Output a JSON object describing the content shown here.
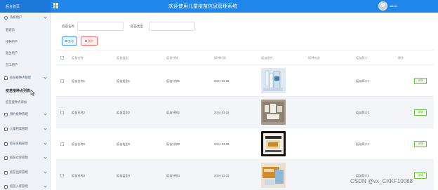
{
  "header": {
    "home": "后台首页",
    "title": "欢迎使用儿童疫苗信息管理系统",
    "username": "admin"
  },
  "sidebar": {
    "items": [
      {
        "label": "系统用户",
        "type": "group",
        "icon": "user-icon"
      },
      {
        "label": "管理员",
        "type": "child"
      },
      {
        "label": "接种用户",
        "type": "child"
      },
      {
        "label": "医生用户",
        "type": "child"
      },
      {
        "label": "员工用户",
        "type": "child"
      },
      {
        "label": "疫苗接种点管理",
        "type": "group",
        "icon": "folder-icon"
      },
      {
        "label": "疫苗接种点列表",
        "type": "active-child"
      },
      {
        "label": "疫苗接种点添加",
        "type": "child"
      },
      {
        "label": "预约接种管理",
        "type": "group",
        "icon": "folder-icon"
      },
      {
        "label": "儿童档案管理",
        "type": "group",
        "icon": "folder-icon"
      },
      {
        "label": "疫苗采购管理",
        "type": "group",
        "icon": "folder-icon"
      },
      {
        "label": "疫苗仓库管理",
        "type": "group",
        "icon": "folder-icon"
      },
      {
        "label": "疫苗出库管理",
        "type": "group",
        "icon": "folder-icon"
      },
      {
        "label": "疫苗入库管理",
        "type": "group",
        "icon": "folder-icon"
      }
    ]
  },
  "search": {
    "name_label": "疫苗名称",
    "type_label": "疫苗类型",
    "name_value": "",
    "type_value": "",
    "query_button": "查询",
    "delete_button": "删除"
  },
  "table": {
    "columns": [
      "疫苗名称",
      "疫苗类型",
      "疫苗针数",
      "接种时间",
      "疫苗图片",
      "接种剂次",
      "疫苗简介",
      "操作"
    ],
    "rows": [
      {
        "name": "疫苗名称1",
        "type": "疫苗类型1",
        "doses": "疫苗针数1",
        "date": "2024-03-26",
        "schedule": "",
        "intro": "疫苗简介1",
        "action": "详情"
      },
      {
        "name": "疫苗名称2",
        "type": "疫苗类型2",
        "doses": "疫苗针数2",
        "date": "2024-03-26",
        "schedule": "",
        "intro": "疫苗简介2",
        "action": "详情"
      },
      {
        "name": "疫苗名称3",
        "type": "疫苗类型3",
        "doses": "疫苗针数3",
        "date": "2024-03-26",
        "schedule": "",
        "intro": "疫苗简介3",
        "action": "详情"
      },
      {
        "name": "疫苗名称4",
        "type": "疫苗类型4",
        "doses": "疫苗针数4",
        "date": "2024-03-26",
        "schedule": "",
        "intro": "疫苗简介4",
        "action": "详情"
      }
    ]
  },
  "watermark": "CSDN @vx_CXKF10088",
  "colors": {
    "header": "#1f86ea",
    "sidebar": "#eef1f6",
    "primary": "#409eff",
    "danger": "#f56c6c",
    "success": "#67c23a"
  }
}
